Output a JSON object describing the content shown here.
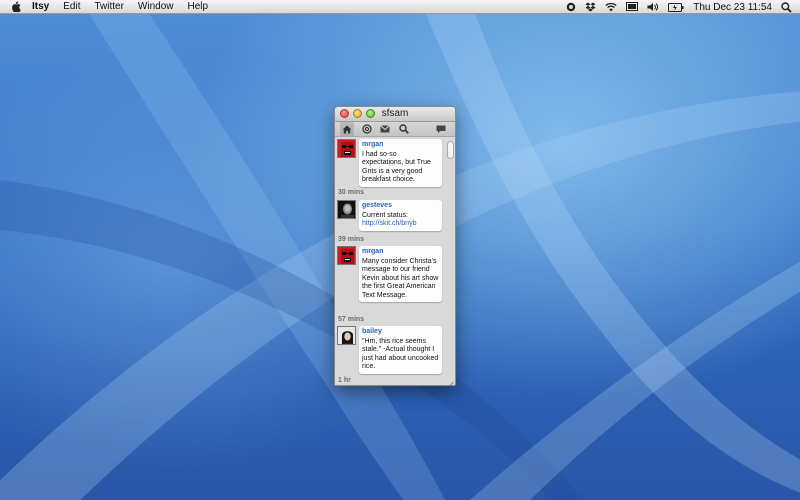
{
  "menubar": {
    "app_name": "Itsy",
    "menus": [
      "Edit",
      "Twitter",
      "Window",
      "Help"
    ],
    "clock": "Thu Dec 23  11:54"
  },
  "window": {
    "title": "sfsam",
    "active_tab": "home-icon"
  },
  "tweets": [
    {
      "user": "mrgan",
      "text": "I had so-so expectations, but True Grits is a very good breakfast choice.",
      "time": "30 mins"
    },
    {
      "user": "gesteves",
      "text": "Current status: ",
      "link": "http://skit.ch/bnyb",
      "time": "39 mins"
    },
    {
      "user": "mrgan",
      "text": "Many consider Christa's message to our friend Kevin about his art show the first Great American Text Message.",
      "time": "57 mins"
    },
    {
      "user": "bailey",
      "text": "\"Hm, this rice seems stale.\" -Actual thought I just had about uncooked rice.",
      "time": "1 hr"
    }
  ],
  "colors": {
    "link": "#2a64b8",
    "desktop": "#3a78c8"
  }
}
